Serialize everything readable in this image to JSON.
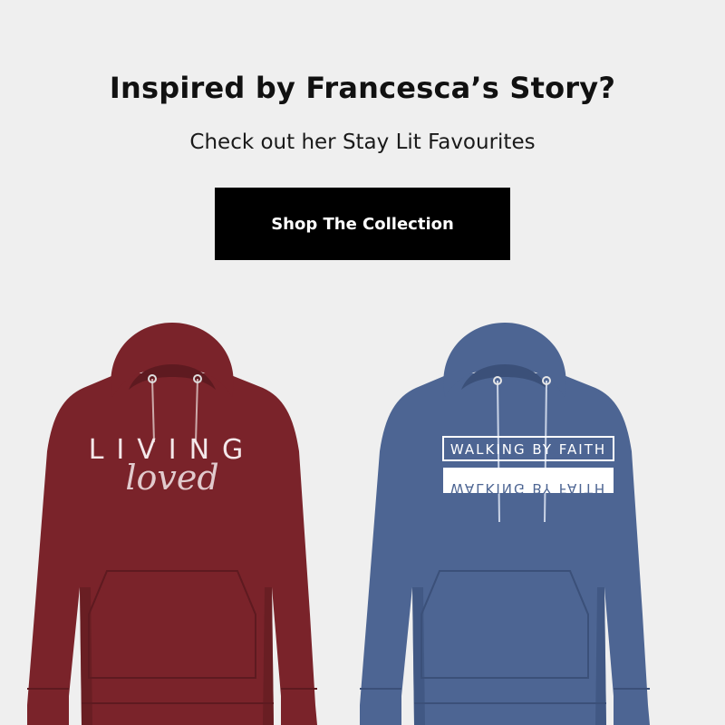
{
  "header": {
    "headline": "Inspired by Francesca’s Story?",
    "subline": "Check out her Stay Lit Favourites"
  },
  "cta": {
    "label": "Shop The Collection"
  },
  "products": [
    {
      "color": "#7a232a",
      "shade": "#5e1a20",
      "print_main": "LIVING",
      "print_script": "loved",
      "print_color": "#f4e8ea"
    },
    {
      "color": "#4d6593",
      "shade": "#3b5079",
      "print_main": "WALKING BY FAITH",
      "print_mirror": "WALKING BY FAITH",
      "print_color": "#ffffff"
    }
  ],
  "colors": {
    "background": "#efefef",
    "button": "#000000",
    "button_text": "#ffffff"
  }
}
